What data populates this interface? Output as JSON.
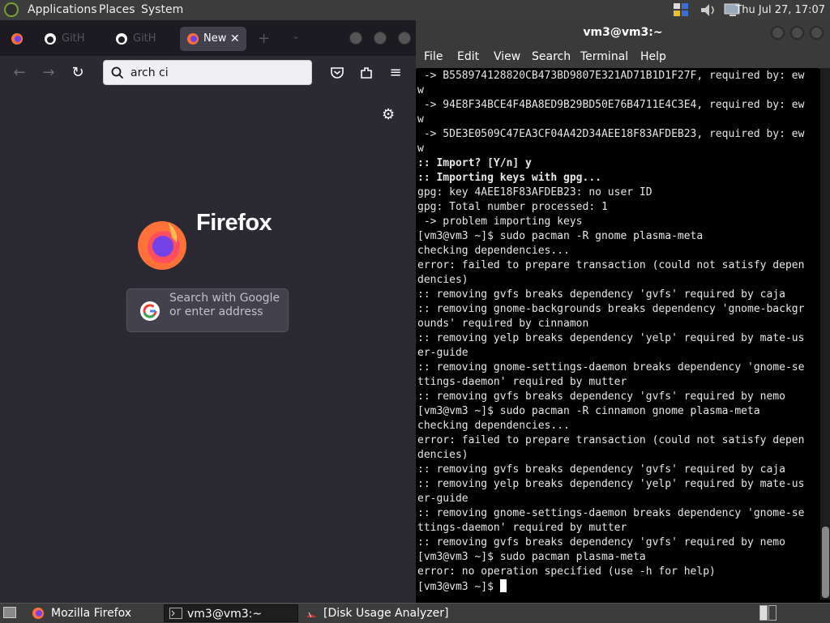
{
  "top_panel": {
    "menus": [
      "Applications",
      "Places",
      "System"
    ],
    "clock": "Thu Jul 27, 17:07"
  },
  "firefox": {
    "tabs": [
      {
        "label": ""
      },
      {
        "label": "GitH"
      },
      {
        "label": "GitH"
      },
      {
        "label": "New"
      }
    ],
    "url": "arch ci",
    "brand": "Firefox",
    "search_placeholder": "Search with Google or enter address"
  },
  "terminal": {
    "title": "vm3@vm3:~",
    "menu": [
      "File",
      "Edit",
      "View",
      "Search",
      "Terminal",
      "Help"
    ],
    "lines": [
      {
        "text": " -> B558974128820CB473BD9807E321AD71B1D1F27F, required by: ew",
        "bold": false
      },
      {
        "text": "w",
        "bold": false
      },
      {
        "text": " -> 94E8F34BCE4F4BA8ED9B29BD50E76B4711E4C3E4, required by: ew",
        "bold": false
      },
      {
        "text": "w",
        "bold": false
      },
      {
        "text": " -> 5DE3E0509C47EA3CF04A42D34AEE18F83AFDEB23, required by: ew",
        "bold": false
      },
      {
        "text": "w",
        "bold": false
      },
      {
        "text": ":: Import? [Y/n] y",
        "bold": true
      },
      {
        "text": ":: Importing keys with gpg...",
        "bold": true
      },
      {
        "text": "gpg: key 4AEE18F83AFDEB23: no user ID",
        "bold": false
      },
      {
        "text": "gpg: Total number processed: 1",
        "bold": false
      },
      {
        "text": " -> problem importing keys",
        "bold": false
      },
      {
        "text": "[vm3@vm3 ~]$ sudo pacman -R gnome plasma-meta",
        "bold": false
      },
      {
        "text": "checking dependencies...",
        "bold": false
      },
      {
        "text": "error: failed to prepare transaction (could not satisfy depen",
        "bold": false
      },
      {
        "text": "dencies)",
        "bold": false
      },
      {
        "text": ":: removing gvfs breaks dependency 'gvfs' required by caja",
        "bold": false
      },
      {
        "text": ":: removing gnome-backgrounds breaks dependency 'gnome-backgr",
        "bold": false
      },
      {
        "text": "ounds' required by cinnamon",
        "bold": false
      },
      {
        "text": ":: removing yelp breaks dependency 'yelp' required by mate-us",
        "bold": false
      },
      {
        "text": "er-guide",
        "bold": false
      },
      {
        "text": ":: removing gnome-settings-daemon breaks dependency 'gnome-se",
        "bold": false
      },
      {
        "text": "ttings-daemon' required by mutter",
        "bold": false
      },
      {
        "text": ":: removing gvfs breaks dependency 'gvfs' required by nemo",
        "bold": false
      },
      {
        "text": "[vm3@vm3 ~]$ sudo pacman -R cinnamon gnome plasma-meta",
        "bold": false
      },
      {
        "text": "checking dependencies...",
        "bold": false
      },
      {
        "text": "error: failed to prepare transaction (could not satisfy depen",
        "bold": false
      },
      {
        "text": "dencies)",
        "bold": false
      },
      {
        "text": ":: removing gvfs breaks dependency 'gvfs' required by caja",
        "bold": false
      },
      {
        "text": ":: removing yelp breaks dependency 'yelp' required by mate-us",
        "bold": false
      },
      {
        "text": "er-guide",
        "bold": false
      },
      {
        "text": ":: removing gnome-settings-daemon breaks dependency 'gnome-se",
        "bold": false
      },
      {
        "text": "ttings-daemon' required by mutter",
        "bold": false
      },
      {
        "text": ":: removing gvfs breaks dependency 'gvfs' required by nemo",
        "bold": false
      },
      {
        "text": "[vm3@vm3 ~]$ sudo pacman plasma-meta",
        "bold": false
      },
      {
        "text": "error: no operation specified (use -h for help)",
        "bold": false
      }
    ],
    "prompt": "[vm3@vm3 ~]$ "
  },
  "taskbar": {
    "tasks": [
      "Mozilla Firefox",
      "vm3@vm3:~",
      "[Disk Usage Analyzer]"
    ]
  }
}
